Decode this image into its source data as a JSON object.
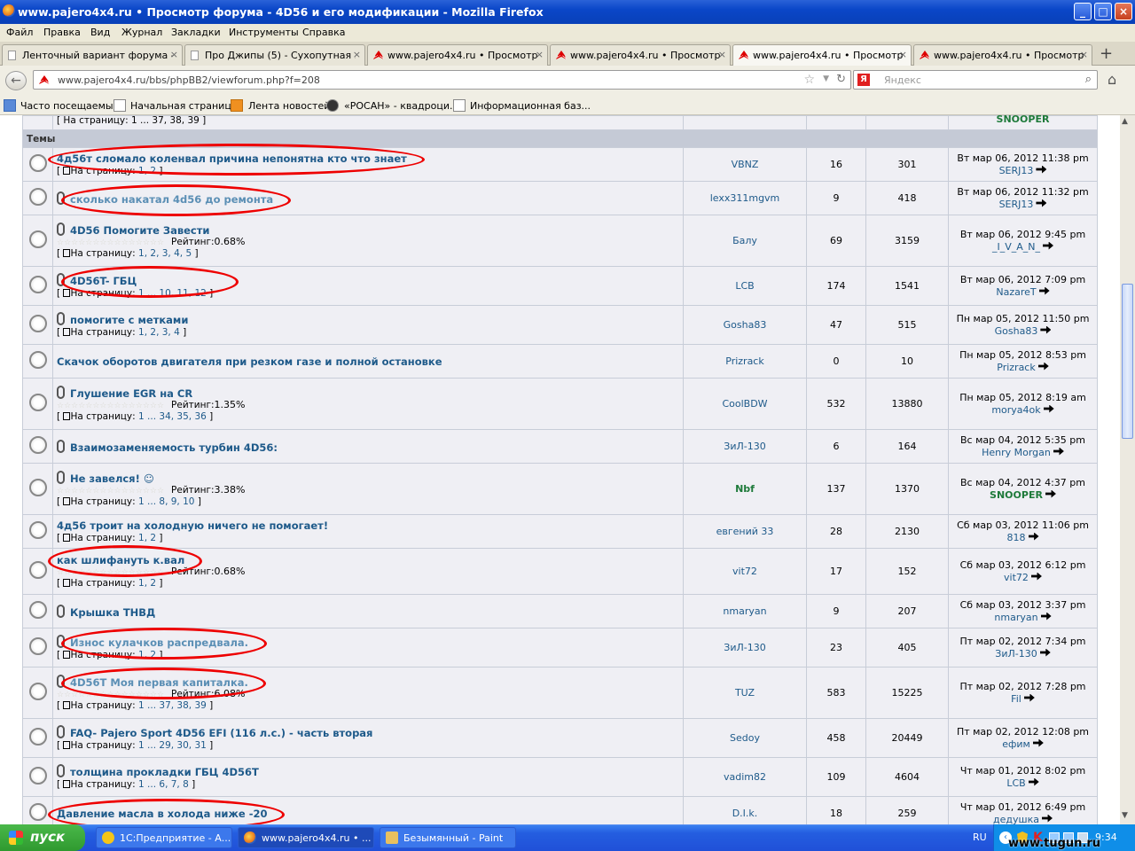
{
  "window": {
    "title": "www.pajero4x4.ru • Просмотр форума - 4D56 и его модификации - Mozilla Firefox",
    "min": "_",
    "max": "□",
    "close": "×"
  },
  "menu": [
    "Файл",
    "Правка",
    "Вид",
    "Журнал",
    "Закладки",
    "Инструменты",
    "Справка"
  ],
  "tabs": [
    {
      "label": "Ленточный вариант форума - ...",
      "icon": "page-icon"
    },
    {
      "label": "Про Джипы (5) - Сухопутная ...",
      "icon": "page-icon"
    },
    {
      "label": "www.pajero4x4.ru • Просмотр ...",
      "icon": "mitsubishi-icon"
    },
    {
      "label": "www.pajero4x4.ru • Просмотр ...",
      "icon": "mitsubishi-icon"
    },
    {
      "label": "www.pajero4x4.ru • Просмотр ...",
      "icon": "mitsubishi-icon",
      "active": true
    },
    {
      "label": "www.pajero4x4.ru • Просмотр ...",
      "icon": "mitsubishi-icon"
    }
  ],
  "tab_close": "×",
  "new_tab": "+",
  "url": "www.pajero4x4.ru/bbs/phpBB2/viewforum.php?f=208",
  "search_placeholder": "Яндекс",
  "bookmarks": [
    "Часто посещаемые",
    "Начальная страница",
    "Лента новостей",
    "«РОСАН» - квадроци...",
    "Информационная баз..."
  ],
  "prev_row": {
    "pages": "[ На страницу: 1 ... 37, 38, 39 ]",
    "last": "SNOOPER"
  },
  "section": "Темы",
  "page_label": "На страницу:",
  "rating_label": "Рейтинг:",
  "topics": [
    {
      "title": "4д56т сломало коленвал причина непонятна кто что знает",
      "clip": false,
      "pages": "1, 2",
      "rating": "",
      "author": "VBNZ",
      "replies": "16",
      "views": "301",
      "date": "Вт мар 06, 2012 11:38 pm",
      "last": "SERJ13",
      "h": 38
    },
    {
      "title": "сколько накатал 4d56 до ремонта",
      "clip": true,
      "pages": "",
      "rating": "",
      "author": "lexx311mgvm",
      "replies": "9",
      "views": "418",
      "date": "Вт мар 06, 2012 11:32 pm",
      "last": "SERJ13",
      "h": 38,
      "faded": true
    },
    {
      "title": "4D56 Помогите Завести",
      "clip": true,
      "pages": "1, 2, 3, 4, 5",
      "rating": "0.68%",
      "author": "Балу",
      "replies": "69",
      "views": "3159",
      "date": "Вт мар 06, 2012 9:45 pm",
      "last": "_I_V_A_N_",
      "h": 58
    },
    {
      "title": "4D56T- ГБЦ",
      "clip": true,
      "pages": "1 ... 10, 11, 12",
      "rating": "",
      "author": "LCB",
      "replies": "174",
      "views": "1541",
      "date": "Вт мар 06, 2012 7:09 pm",
      "last": "NazareT",
      "h": 44
    },
    {
      "title": "помогите с метками",
      "clip": true,
      "pages": "1, 2, 3, 4",
      "rating": "",
      "author": "Gosha83",
      "replies": "47",
      "views": "515",
      "date": "Пн мар 05, 2012 11:50 pm",
      "last": "Gosha83",
      "h": 44
    },
    {
      "title": "Скачок оборотов двигателя при резком газе и полной остановке",
      "clip": false,
      "pages": "",
      "rating": "",
      "author": "Prizrack",
      "replies": "0",
      "views": "10",
      "date": "Пн мар 05, 2012 8:53 pm",
      "last": "Prizrack",
      "h": 38
    },
    {
      "title": "Глушение EGR на CR",
      "clip": true,
      "pages": "1 ... 34, 35, 36",
      "rating": "1.35%",
      "author": "CoolBDW",
      "replies": "532",
      "views": "13880",
      "date": "Пн мар 05, 2012 8:19 am",
      "last": "morya4ok",
      "h": 58
    },
    {
      "title": "Взаимозаменяемость турбин 4D56:",
      "clip": true,
      "pages": "",
      "rating": "",
      "author": "ЗиЛ-130",
      "replies": "6",
      "views": "164",
      "date": "Вс мар 04, 2012 5:35 pm",
      "last": "Henry Morgan",
      "h": 38
    },
    {
      "title": "Не завелся! ☺",
      "clip": true,
      "pages": "1 ... 8, 9, 10",
      "rating": "3.38%",
      "author": "Nbf",
      "replies": "137",
      "views": "1370",
      "date": "Вс мар 04, 2012 4:37 pm",
      "last": "SNOOPER",
      "h": 58,
      "green": true
    },
    {
      "title": "4д56 троит на холодную ничего не помогает!",
      "clip": false,
      "pages": "1, 2",
      "rating": "",
      "author": "евгений 33",
      "replies": "28",
      "views": "2130",
      "date": "Сб мар 03, 2012 11:06 pm",
      "last": "818",
      "h": 38
    },
    {
      "title": "как шлифануть к.вал",
      "clip": false,
      "pages": "1, 2",
      "rating": "0.68%",
      "author": "vit72",
      "replies": "17",
      "views": "152",
      "date": "Сб мар 03, 2012 6:12 pm",
      "last": "vit72",
      "h": 52
    },
    {
      "title": "Крышка ТНВД",
      "clip": true,
      "pages": "",
      "rating": "",
      "author": "nmaryan",
      "replies": "9",
      "views": "207",
      "date": "Сб мар 03, 2012 3:37 pm",
      "last": "nmaryan",
      "h": 38
    },
    {
      "title": "Износ кулачков распредвала.",
      "clip": true,
      "pages": "1, 2",
      "rating": "",
      "author": "ЗиЛ-130",
      "replies": "23",
      "views": "405",
      "date": "Пт мар 02, 2012 7:34 pm",
      "last": "ЗиЛ-130",
      "h": 44,
      "faded": true
    },
    {
      "title": "4D56T Моя первая капиталка.",
      "clip": true,
      "pages": "1 ... 37, 38, 39",
      "rating": "6.08%",
      "author": "TUZ",
      "replies": "583",
      "views": "15225",
      "date": "Пт мар 02, 2012 7:28 pm",
      "last": "Fil",
      "h": 58,
      "faded": true
    },
    {
      "title": "FAQ- Pajero Sport 4D56 EFI (116 л.с.) - часть вторая",
      "clip": true,
      "pages": "1 ... 29, 30, 31",
      "rating": "",
      "author": "Sedoy",
      "replies": "458",
      "views": "20449",
      "date": "Пт мар 02, 2012 12:08 pm",
      "last": "ефим",
      "h": 44
    },
    {
      "title": "толщина прокладки ГБЦ 4D56T",
      "clip": true,
      "pages": "1 ... 6, 7, 8",
      "rating": "",
      "author": "vadim82",
      "replies": "109",
      "views": "4604",
      "date": "Чт мар 01, 2012 8:02 pm",
      "last": "LCB",
      "h": 44
    },
    {
      "title": "Давление масла в холода ниже -20",
      "clip": false,
      "pages": "",
      "rating": "",
      "author": "D.I.k.",
      "replies": "18",
      "views": "259",
      "date": "Чт мар 01, 2012 6:49 pm",
      "last": "дедушка",
      "h": 38
    }
  ],
  "taskbar": {
    "start": "пуск",
    "buttons": [
      "1С:Предприятие - А...",
      "www.pajero4x4.ru • ...",
      "Безымянный - Paint"
    ],
    "lang": "RU",
    "clock": "9:34",
    "watermark": "www.tugun.ru"
  },
  "colors": {
    "titlebar": "#0a46c8",
    "link": "#1e5a8a",
    "circle": "#e00000",
    "row": "#efeff4",
    "header": "#c5cad6"
  }
}
